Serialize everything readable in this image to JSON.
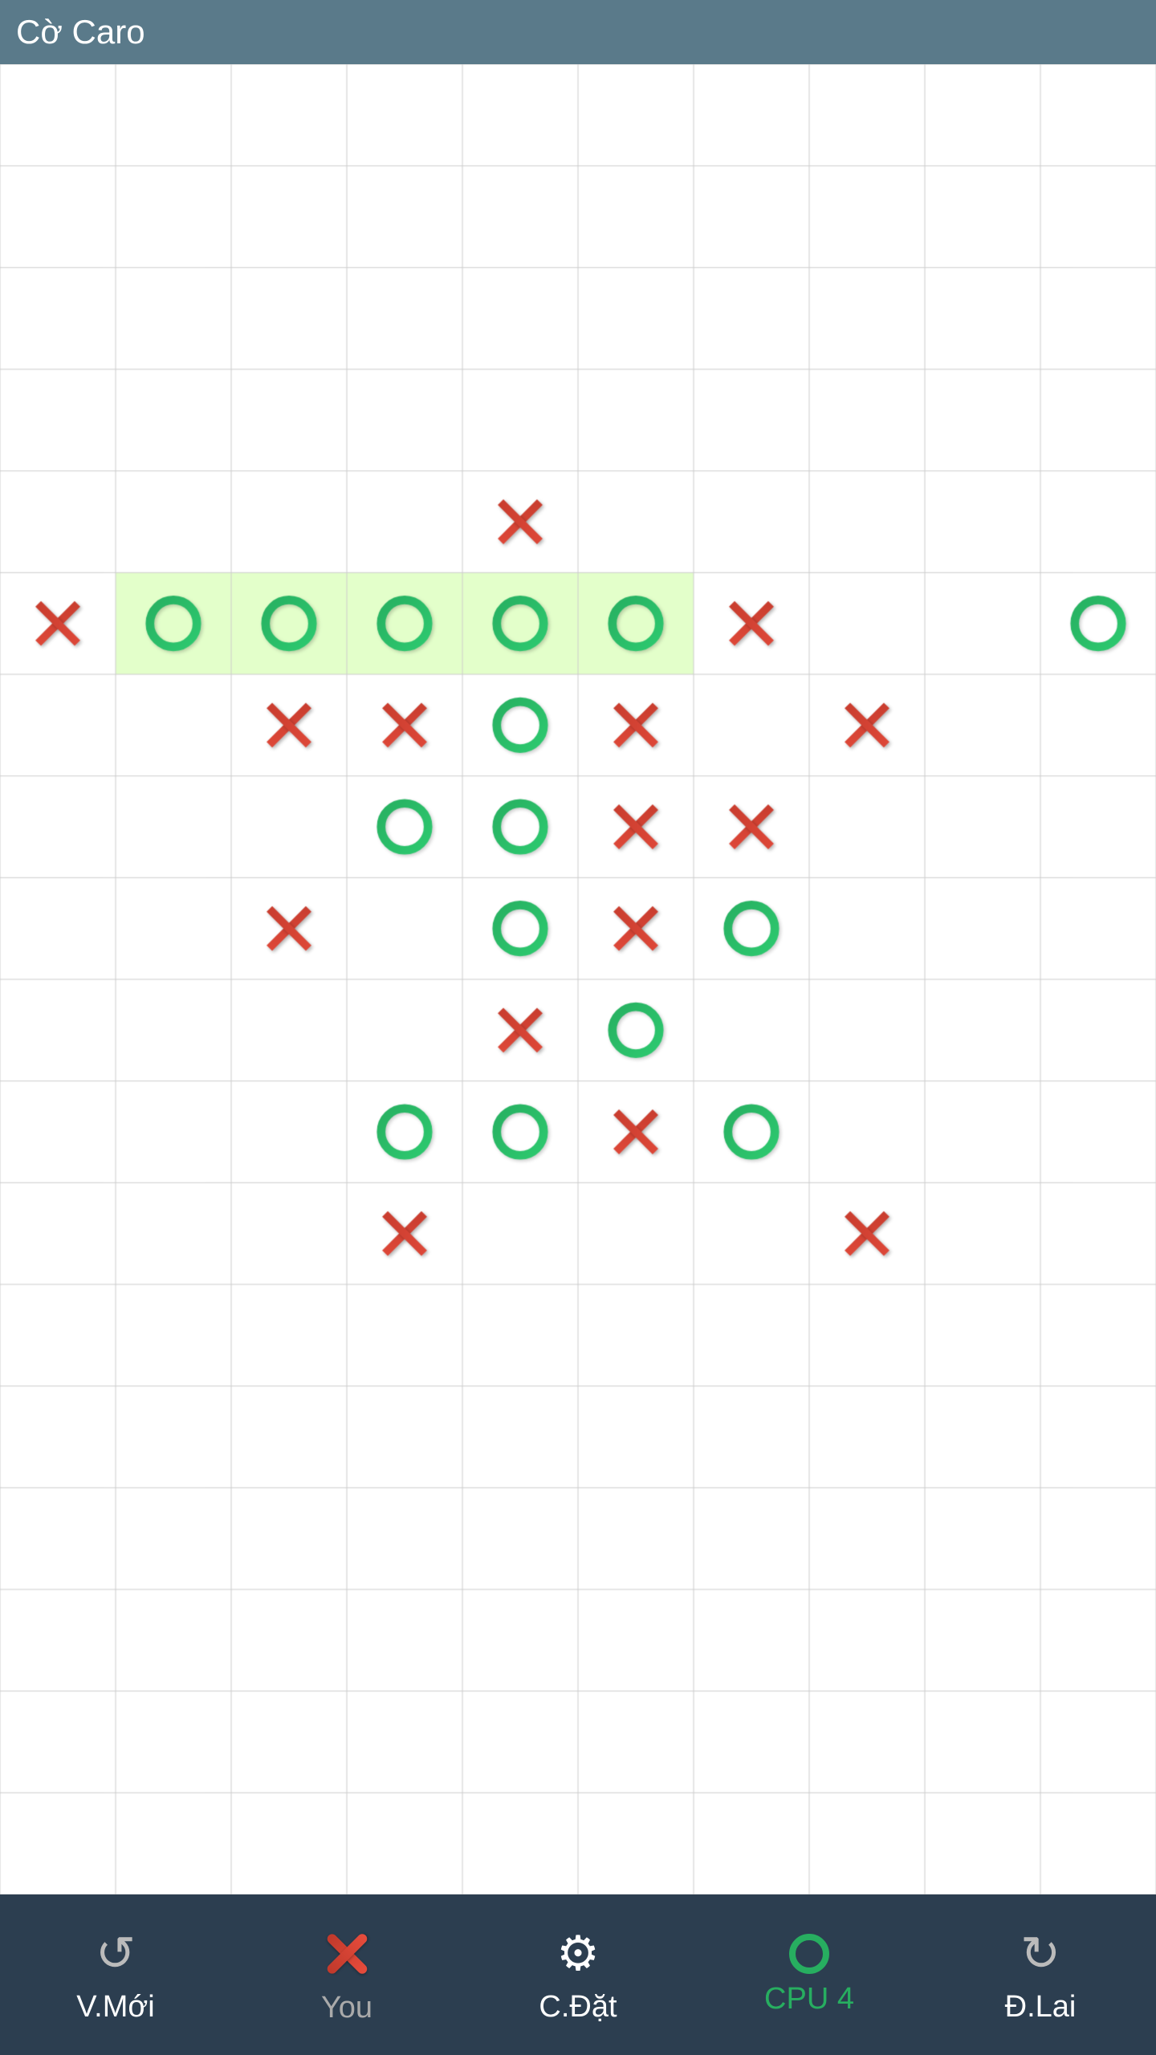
{
  "header": {
    "title": "Cờ Caro"
  },
  "board": {
    "cols": 10,
    "rows": 18,
    "cell_size": 144,
    "highlight": {
      "row": 5,
      "col_start": 1,
      "col_end": 5
    },
    "pieces": [
      {
        "type": "X",
        "row": 4,
        "col": 4
      },
      {
        "type": "X",
        "row": 5,
        "col": 0
      },
      {
        "type": "O",
        "row": 5,
        "col": 1,
        "highlighted": true
      },
      {
        "type": "O",
        "row": 5,
        "col": 2,
        "highlighted": true
      },
      {
        "type": "O",
        "row": 5,
        "col": 3,
        "highlighted": true
      },
      {
        "type": "O",
        "row": 5,
        "col": 4,
        "highlighted": true
      },
      {
        "type": "O",
        "row": 5,
        "col": 5,
        "highlighted": true
      },
      {
        "type": "X",
        "row": 5,
        "col": 6
      },
      {
        "type": "O",
        "row": 5,
        "col": 9
      },
      {
        "type": "X",
        "row": 6,
        "col": 2
      },
      {
        "type": "X",
        "row": 6,
        "col": 3
      },
      {
        "type": "O",
        "row": 6,
        "col": 4
      },
      {
        "type": "X",
        "row": 6,
        "col": 5
      },
      {
        "type": "X",
        "row": 6,
        "col": 7
      },
      {
        "type": "O",
        "row": 7,
        "col": 3
      },
      {
        "type": "O",
        "row": 7,
        "col": 4
      },
      {
        "type": "X",
        "row": 7,
        "col": 5
      },
      {
        "type": "X",
        "row": 7,
        "col": 6
      },
      {
        "type": "X",
        "row": 8,
        "col": 2
      },
      {
        "type": "O",
        "row": 8,
        "col": 4
      },
      {
        "type": "X",
        "row": 8,
        "col": 5
      },
      {
        "type": "O",
        "row": 8,
        "col": 6
      },
      {
        "type": "X",
        "row": 9,
        "col": 4
      },
      {
        "type": "O",
        "row": 9,
        "col": 5
      },
      {
        "type": "O",
        "row": 10,
        "col": 3
      },
      {
        "type": "O",
        "row": 10,
        "col": 4
      },
      {
        "type": "X",
        "row": 10,
        "col": 5
      },
      {
        "type": "O",
        "row": 10,
        "col": 6
      },
      {
        "type": "X",
        "row": 11,
        "col": 3
      },
      {
        "type": "X",
        "row": 11,
        "col": 7
      }
    ]
  },
  "bottom_bar": {
    "buttons": [
      {
        "id": "new-game",
        "label": "V.Mới",
        "icon": "new-icon"
      },
      {
        "id": "you",
        "label": "You",
        "icon": "you-icon"
      },
      {
        "id": "settings",
        "label": "C.Đặt",
        "icon": "gear-icon"
      },
      {
        "id": "cpu4",
        "label": "CPU 4",
        "icon": "circle-icon"
      },
      {
        "id": "undo",
        "label": "Đ.Lai",
        "icon": "undo-icon"
      }
    ]
  }
}
